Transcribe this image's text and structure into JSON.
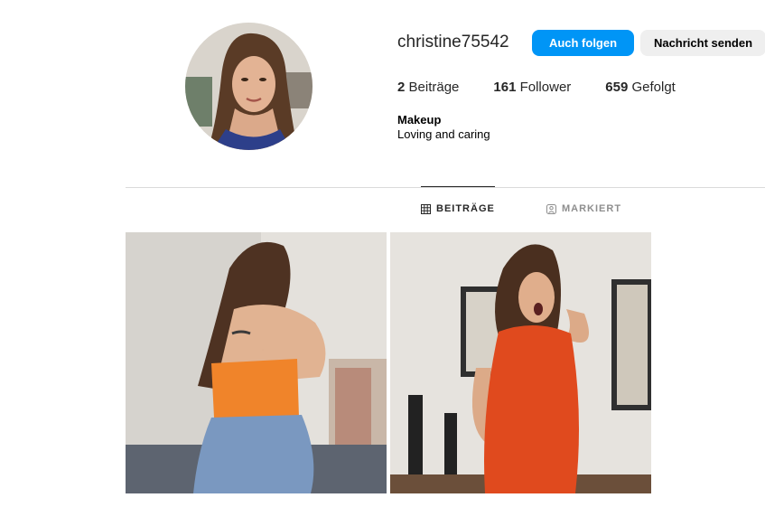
{
  "profile": {
    "username": "christine75542",
    "follow_label": "Auch folgen",
    "message_label": "Nachricht senden",
    "stats": {
      "posts_count": "2",
      "posts_label": "Beiträge",
      "followers_count": "161",
      "followers_label": "Follower",
      "following_count": "659",
      "following_label": "Gefolgt"
    },
    "bio_name": "Makeup",
    "bio_text": "Loving and caring"
  },
  "tabs": [
    {
      "label": "BEITRÄGE",
      "icon": "grid-icon",
      "active": true
    },
    {
      "label": "MARKIERT",
      "icon": "tag-user-icon",
      "active": false
    }
  ],
  "colors": {
    "primary_blue": "#0095f6",
    "secondary_button": "#efefef",
    "divider": "#dbdbdb"
  }
}
